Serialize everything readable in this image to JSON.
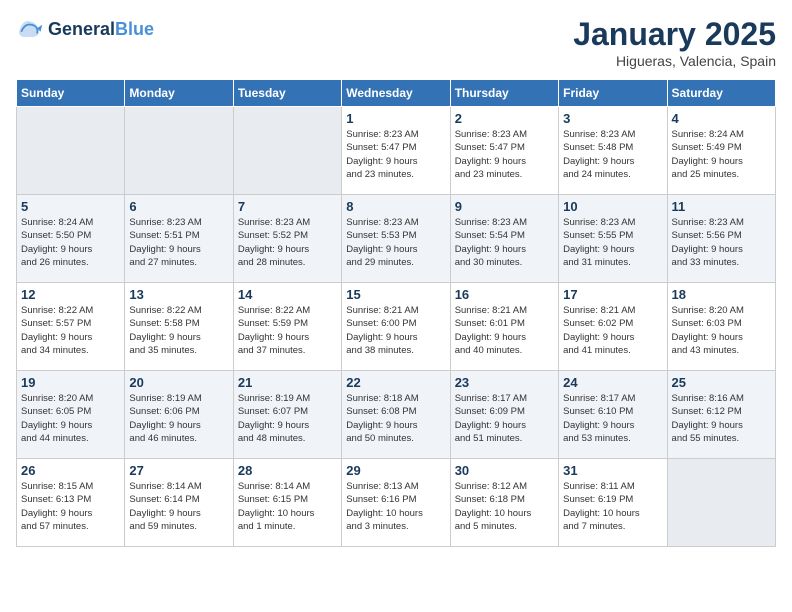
{
  "logo": {
    "line1": "General",
    "line2": "Blue"
  },
  "title": "January 2025",
  "subtitle": "Higueras, Valencia, Spain",
  "days_of_week": [
    "Sunday",
    "Monday",
    "Tuesday",
    "Wednesday",
    "Thursday",
    "Friday",
    "Saturday"
  ],
  "weeks": [
    [
      {
        "day": "",
        "info": ""
      },
      {
        "day": "",
        "info": ""
      },
      {
        "day": "",
        "info": ""
      },
      {
        "day": "1",
        "info": "Sunrise: 8:23 AM\nSunset: 5:47 PM\nDaylight: 9 hours\nand 23 minutes."
      },
      {
        "day": "2",
        "info": "Sunrise: 8:23 AM\nSunset: 5:47 PM\nDaylight: 9 hours\nand 23 minutes."
      },
      {
        "day": "3",
        "info": "Sunrise: 8:23 AM\nSunset: 5:48 PM\nDaylight: 9 hours\nand 24 minutes."
      },
      {
        "day": "4",
        "info": "Sunrise: 8:24 AM\nSunset: 5:49 PM\nDaylight: 9 hours\nand 25 minutes."
      }
    ],
    [
      {
        "day": "5",
        "info": "Sunrise: 8:24 AM\nSunset: 5:50 PM\nDaylight: 9 hours\nand 26 minutes."
      },
      {
        "day": "6",
        "info": "Sunrise: 8:23 AM\nSunset: 5:51 PM\nDaylight: 9 hours\nand 27 minutes."
      },
      {
        "day": "7",
        "info": "Sunrise: 8:23 AM\nSunset: 5:52 PM\nDaylight: 9 hours\nand 28 minutes."
      },
      {
        "day": "8",
        "info": "Sunrise: 8:23 AM\nSunset: 5:53 PM\nDaylight: 9 hours\nand 29 minutes."
      },
      {
        "day": "9",
        "info": "Sunrise: 8:23 AM\nSunset: 5:54 PM\nDaylight: 9 hours\nand 30 minutes."
      },
      {
        "day": "10",
        "info": "Sunrise: 8:23 AM\nSunset: 5:55 PM\nDaylight: 9 hours\nand 31 minutes."
      },
      {
        "day": "11",
        "info": "Sunrise: 8:23 AM\nSunset: 5:56 PM\nDaylight: 9 hours\nand 33 minutes."
      }
    ],
    [
      {
        "day": "12",
        "info": "Sunrise: 8:22 AM\nSunset: 5:57 PM\nDaylight: 9 hours\nand 34 minutes."
      },
      {
        "day": "13",
        "info": "Sunrise: 8:22 AM\nSunset: 5:58 PM\nDaylight: 9 hours\nand 35 minutes."
      },
      {
        "day": "14",
        "info": "Sunrise: 8:22 AM\nSunset: 5:59 PM\nDaylight: 9 hours\nand 37 minutes."
      },
      {
        "day": "15",
        "info": "Sunrise: 8:21 AM\nSunset: 6:00 PM\nDaylight: 9 hours\nand 38 minutes."
      },
      {
        "day": "16",
        "info": "Sunrise: 8:21 AM\nSunset: 6:01 PM\nDaylight: 9 hours\nand 40 minutes."
      },
      {
        "day": "17",
        "info": "Sunrise: 8:21 AM\nSunset: 6:02 PM\nDaylight: 9 hours\nand 41 minutes."
      },
      {
        "day": "18",
        "info": "Sunrise: 8:20 AM\nSunset: 6:03 PM\nDaylight: 9 hours\nand 43 minutes."
      }
    ],
    [
      {
        "day": "19",
        "info": "Sunrise: 8:20 AM\nSunset: 6:05 PM\nDaylight: 9 hours\nand 44 minutes."
      },
      {
        "day": "20",
        "info": "Sunrise: 8:19 AM\nSunset: 6:06 PM\nDaylight: 9 hours\nand 46 minutes."
      },
      {
        "day": "21",
        "info": "Sunrise: 8:19 AM\nSunset: 6:07 PM\nDaylight: 9 hours\nand 48 minutes."
      },
      {
        "day": "22",
        "info": "Sunrise: 8:18 AM\nSunset: 6:08 PM\nDaylight: 9 hours\nand 50 minutes."
      },
      {
        "day": "23",
        "info": "Sunrise: 8:17 AM\nSunset: 6:09 PM\nDaylight: 9 hours\nand 51 minutes."
      },
      {
        "day": "24",
        "info": "Sunrise: 8:17 AM\nSunset: 6:10 PM\nDaylight: 9 hours\nand 53 minutes."
      },
      {
        "day": "25",
        "info": "Sunrise: 8:16 AM\nSunset: 6:12 PM\nDaylight: 9 hours\nand 55 minutes."
      }
    ],
    [
      {
        "day": "26",
        "info": "Sunrise: 8:15 AM\nSunset: 6:13 PM\nDaylight: 9 hours\nand 57 minutes."
      },
      {
        "day": "27",
        "info": "Sunrise: 8:14 AM\nSunset: 6:14 PM\nDaylight: 9 hours\nand 59 minutes."
      },
      {
        "day": "28",
        "info": "Sunrise: 8:14 AM\nSunset: 6:15 PM\nDaylight: 10 hours\nand 1 minute."
      },
      {
        "day": "29",
        "info": "Sunrise: 8:13 AM\nSunset: 6:16 PM\nDaylight: 10 hours\nand 3 minutes."
      },
      {
        "day": "30",
        "info": "Sunrise: 8:12 AM\nSunset: 6:18 PM\nDaylight: 10 hours\nand 5 minutes."
      },
      {
        "day": "31",
        "info": "Sunrise: 8:11 AM\nSunset: 6:19 PM\nDaylight: 10 hours\nand 7 minutes."
      },
      {
        "day": "",
        "info": ""
      }
    ]
  ]
}
